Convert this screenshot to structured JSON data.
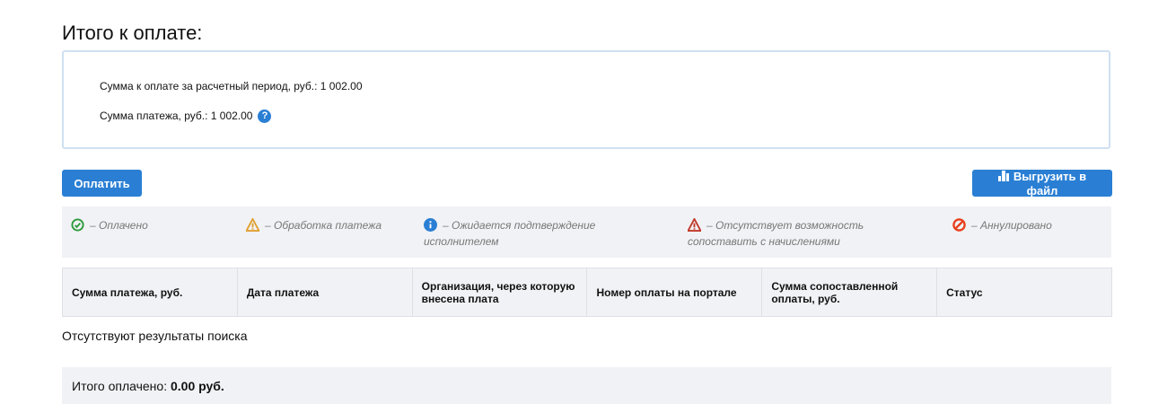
{
  "title": "Итого к оплате:",
  "summary": {
    "period_label": "Сумма к оплате за расчетный период, руб.: 1 002.00",
    "payment_label": "Сумма платежа, руб.: 1 002.00",
    "help_icon": "?"
  },
  "buttons": {
    "pay": "Оплатить",
    "export": "Выгрузить в файл"
  },
  "legend": [
    {
      "icon": "check-circle",
      "color": "#2e9b3c",
      "text": "– Оплачено"
    },
    {
      "icon": "warning",
      "color": "#e0a030",
      "text": "– Обработка платежа"
    },
    {
      "icon": "info",
      "color": "#2a7fd4",
      "text": "– Ожидается подтверждение исполнителем"
    },
    {
      "icon": "warning",
      "color": "#c0392b",
      "text": "– Отсутствует возможность сопоставить с начислениями"
    },
    {
      "icon": "ban",
      "color": "#e8401c",
      "text": "– Аннулировано"
    }
  ],
  "table": {
    "headers": [
      "Сумма платежа, руб.",
      "Дата платежа",
      "Организация, через которую внесена плата",
      "Номер оплаты на портале",
      "Сумма сопоставленной оплаты, руб.",
      "Статус"
    ]
  },
  "empty": "Отсутствуют результаты поиска",
  "total": {
    "label": "Итого оплачено:",
    "value": "0.00 руб."
  }
}
